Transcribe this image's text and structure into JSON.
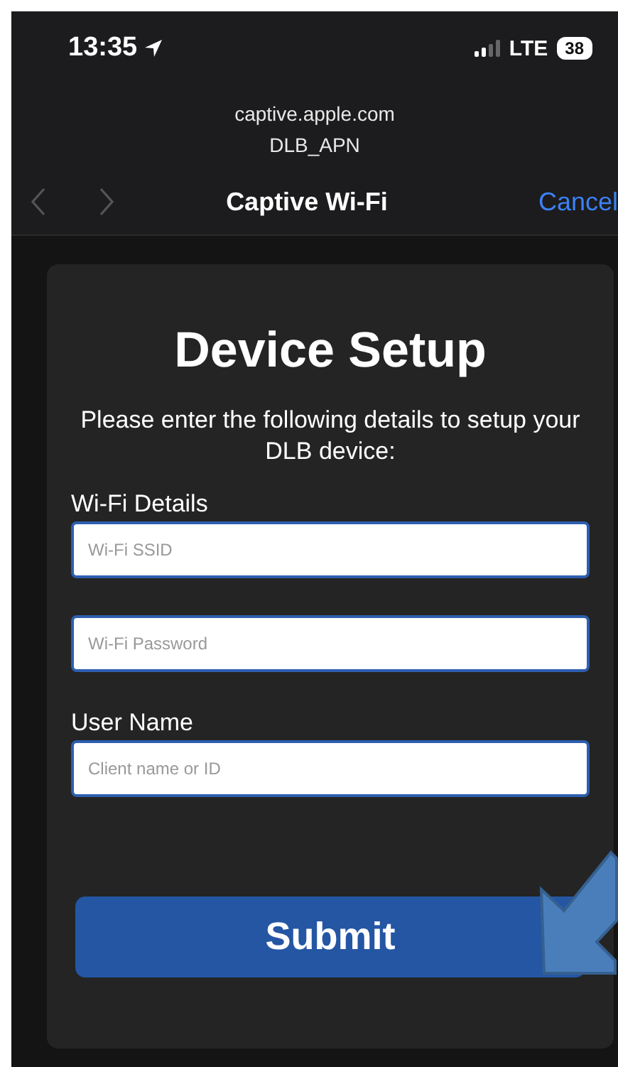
{
  "status_bar": {
    "time": "13:35",
    "network": "LTE",
    "battery": "38"
  },
  "browser": {
    "url": "captive.apple.com",
    "network_name": "DLB_APN"
  },
  "nav": {
    "back": {
      "disabled": true
    },
    "forward": {
      "disabled": true
    },
    "title": "Captive Wi-Fi",
    "cancel": "Cancel"
  },
  "form": {
    "title": "Device Setup",
    "instructions": "Please enter the following details to setup your DLB device:",
    "fields": [
      {
        "label": "Wi-Fi Details",
        "placeholder": "Wi-Fi SSID"
      },
      {
        "placeholder": "Wi-Fi Password"
      },
      {
        "label": "User Name",
        "placeholder": "Client name or ID"
      }
    ],
    "submit": "Submit"
  }
}
